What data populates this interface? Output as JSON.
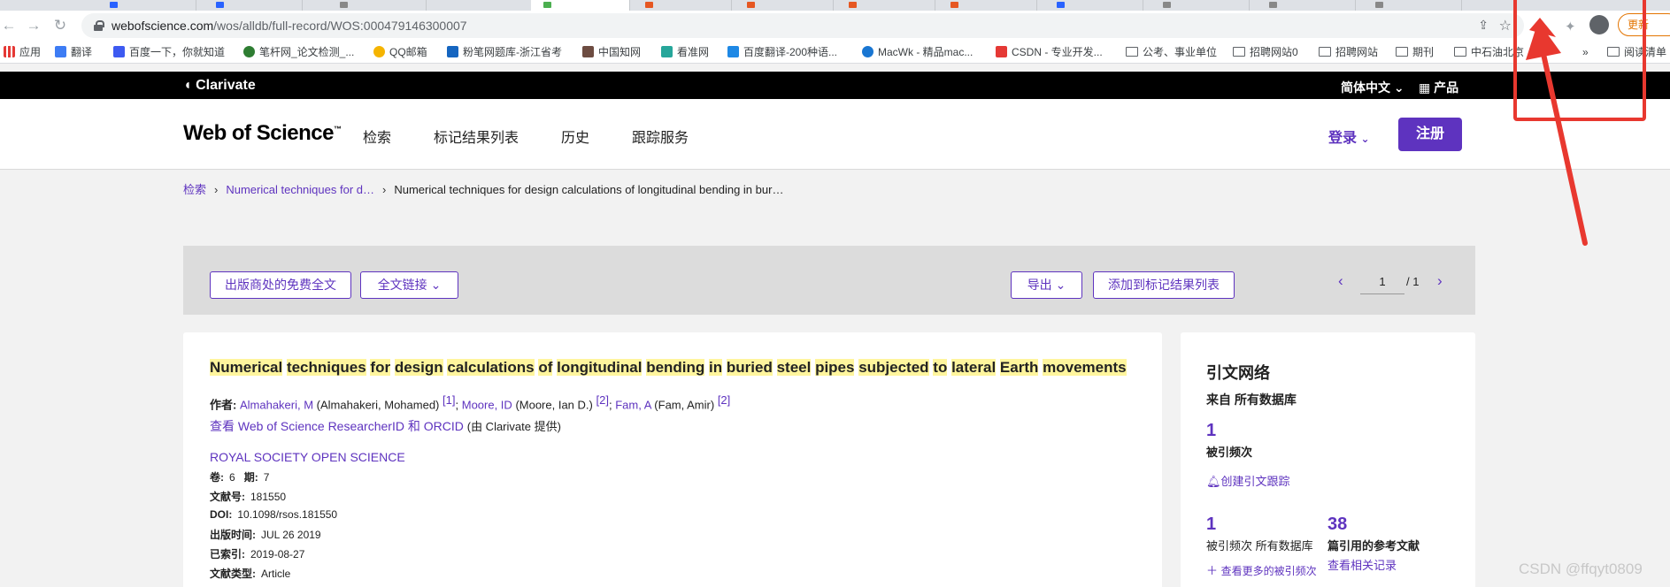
{
  "browser": {
    "url_host": "webofscience.com",
    "url_path": "/wos/alldb/full-record/WOS:000479146300007",
    "update_label": "更新",
    "bookmarks": [
      {
        "label": "应用",
        "color": "#e53935"
      },
      {
        "label": "翻译",
        "color": "#3d7cf4"
      },
      {
        "label": "百度一下，你就知道",
        "color": "#3d5af1"
      },
      {
        "label": "笔杆网_论文检测_...",
        "color": "#2e7d32"
      },
      {
        "label": "QQ邮箱",
        "color": "#f5b400"
      },
      {
        "label": "粉笔网题库-浙江省考",
        "color": "#1565c0"
      },
      {
        "label": "中国知网",
        "color": "#6d4c41"
      },
      {
        "label": "看准网",
        "color": "#26a69a"
      },
      {
        "label": "百度翻译-200种语...",
        "color": "#1e88e5"
      },
      {
        "label": "MacWk - 精品mac...",
        "color": "#1976d2"
      },
      {
        "label": "CSDN - 专业开发...",
        "color": "#e53935"
      },
      {
        "label": "公考、事业单位",
        "color": "folder"
      },
      {
        "label": "招聘网站0",
        "color": "folder"
      },
      {
        "label": "招聘网站",
        "color": "folder"
      },
      {
        "label": "期刊",
        "color": "folder"
      },
      {
        "label": "中石油北京",
        "color": "folder"
      }
    ],
    "reading_list_label": "阅读清单",
    "more_bookmarks": "»"
  },
  "clarivate": {
    "logo": "Clarivate",
    "language": "简体中文",
    "products": "产品"
  },
  "header": {
    "logo": "Web of Science",
    "tm": "™",
    "nav": [
      "检索",
      "标记结果列表",
      "历史",
      "跟踪服务"
    ],
    "login": "登录",
    "register": "注册"
  },
  "breadcrumb": {
    "root": "检索",
    "middle": "Numerical techniques for d…",
    "current": "Numerical techniques for design calculations of longitudinal bending in bur…"
  },
  "toolbar": {
    "free_fulltext": "出版商处的免费全文",
    "fulltext_links": "全文链接",
    "export": "导出",
    "add_marked": "添加到标记结果列表",
    "page_current": "1",
    "page_total": "/ 1"
  },
  "record": {
    "title_words": [
      "Numerical",
      "techniques",
      "for",
      "design",
      "calculations",
      "of",
      "longitudinal",
      "bending",
      "in",
      "buried",
      "steel",
      "pipes",
      "subjected",
      "to",
      "lateral",
      "Earth",
      "movements"
    ],
    "authors_label": "作者:",
    "authors": [
      {
        "short": "Almahakeri, M",
        "full": "(Almahakeri, Mohamed)",
        "ref": "[1]",
        "sep": ";"
      },
      {
        "short": "Moore, ID",
        "full": "(Moore, Ian D.)",
        "ref": "[2]",
        "sep": ";"
      },
      {
        "short": "Fam, A",
        "full": "(Fam, Amir)",
        "ref": "[2]",
        "sep": ""
      }
    ],
    "researcher_link": "查看 Web of Science ResearcherID 和 ORCID",
    "researcher_note": "(由 Clarivate 提供)",
    "journal": "ROYAL SOCIETY OPEN SCIENCE",
    "volume_label": "卷:",
    "volume": "6",
    "issue_label": "期:",
    "issue": "7",
    "article_no_label": "文献号:",
    "article_no": "181550",
    "doi_label": "DOI:",
    "doi": "10.1098/rsos.181550",
    "pub_date_label": "出版时间:",
    "pub_date": "JUL 26 2019",
    "indexed_label": "已索引:",
    "indexed": "2019-08-27",
    "doc_type_label": "文献类型:",
    "doc_type": "Article"
  },
  "citation": {
    "title": "引文网络",
    "from": "来自 所有数据库",
    "cited_count": "1",
    "cited_label": "被引频次",
    "create_alert": "创建引文跟踪",
    "all_db_count": "1",
    "all_db_label": "被引频次 所有数据库",
    "refs_count": "38",
    "refs_label": "篇引用的参考文献",
    "more_cited": "查看更多的被引频次",
    "related": "查看相关记录"
  },
  "watermark": "CSDN @ffqyt0809"
}
